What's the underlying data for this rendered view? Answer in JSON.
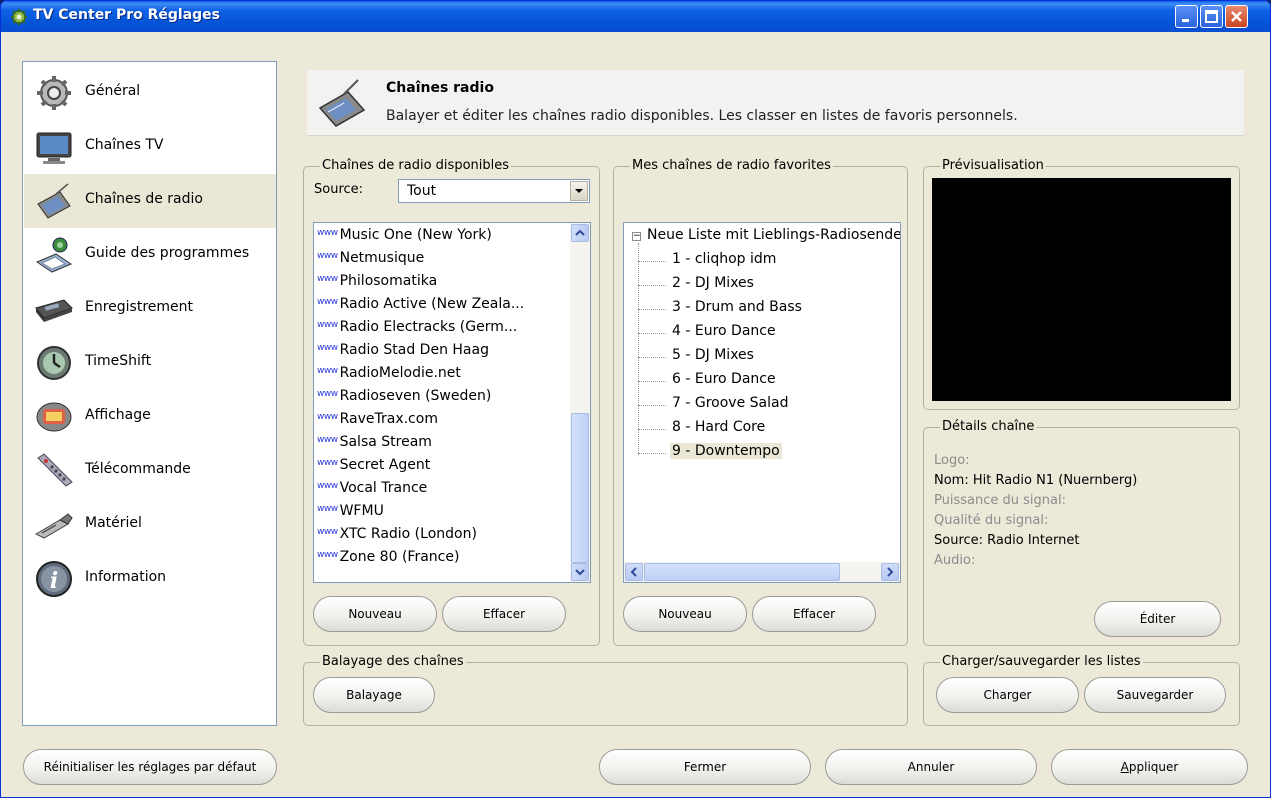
{
  "window": {
    "title": "TV Center Pro Réglages"
  },
  "sidebar": {
    "items": [
      {
        "label": "Général",
        "icon": "gear-icon"
      },
      {
        "label": "Chaînes TV",
        "icon": "tv-icon"
      },
      {
        "label": "Chaînes de radio",
        "icon": "radio-icon",
        "selected": true
      },
      {
        "label": "Guide des programmes",
        "icon": "program-guide-icon"
      },
      {
        "label": "Enregistrement",
        "icon": "vcr-icon"
      },
      {
        "label": "TimeShift",
        "icon": "timeshift-icon"
      },
      {
        "label": "Affichage",
        "icon": "display-icon"
      },
      {
        "label": "Télécommande",
        "icon": "remote-control-icon"
      },
      {
        "label": "Matériel",
        "icon": "hardware-icon"
      },
      {
        "label": "Information",
        "icon": "info-icon"
      }
    ],
    "reset_label": "Réinitialiser les réglages par défaut"
  },
  "header": {
    "title": "Chaînes radio",
    "description": "Balayer et éditer les chaînes radio disponibles. Les classer en listes de favoris personnels."
  },
  "available": {
    "legend": "Chaînes de radio disponibles",
    "source_label": "Source:",
    "source_value": "Tout",
    "badge": "www",
    "items": [
      "Music One (New York)",
      "Netmusique",
      "Philosomatika",
      "Radio Active (New Zeala...",
      "Radio Electracks (Germ...",
      "Radio Stad Den Haag",
      "RadioMelodie.net",
      "Radioseven (Sweden)",
      "RaveTrax.com",
      "Salsa Stream",
      "Secret Agent",
      "Vocal Trance",
      "WFMU",
      "XTC Radio (London)",
      "Zone 80 (France)"
    ],
    "new_label": "Nouveau",
    "delete_label": "Effacer"
  },
  "favorites": {
    "legend": "Mes chaînes de radio favorites",
    "root": "Neue Liste mit Lieblings-Radiosender",
    "items": [
      "1 - cliqhop idm",
      "2 - DJ Mixes",
      "3 - Drum and Bass",
      "4 - Euro Dance",
      "5 - DJ Mixes",
      "6 - Euro Dance",
      "7 - Groove Salad",
      "8 - Hard Core",
      "9 - Downtempo"
    ],
    "selected_index": 8,
    "new_label": "Nouveau",
    "delete_label": "Effacer"
  },
  "preview": {
    "legend": "Prévisualisation"
  },
  "details": {
    "legend": "Détails chaîne",
    "logo": "Logo:",
    "name": "Nom: Hit Radio N1 (Nuernberg)",
    "signal_strength": "Puissance du signal:",
    "signal_quality": "Qualité du signal:",
    "source": "Source: Radio Internet",
    "audio": "Audio:",
    "edit_label": "Éditer"
  },
  "scan": {
    "legend": "Balayage des chaînes",
    "scan_label": "Balayage"
  },
  "lists": {
    "legend": "Charger/sauvegarder les listes",
    "load_label": "Charger",
    "save_label": "Sauvegarder"
  },
  "footer": {
    "close_label": "Fermer",
    "cancel_label": "Annuler",
    "apply_label": "Appliquer"
  },
  "colors": {
    "titlebar": "#0554d8",
    "panel": "#ece9d8",
    "selection": "#ebe7d7",
    "border": "#7f9db9"
  }
}
